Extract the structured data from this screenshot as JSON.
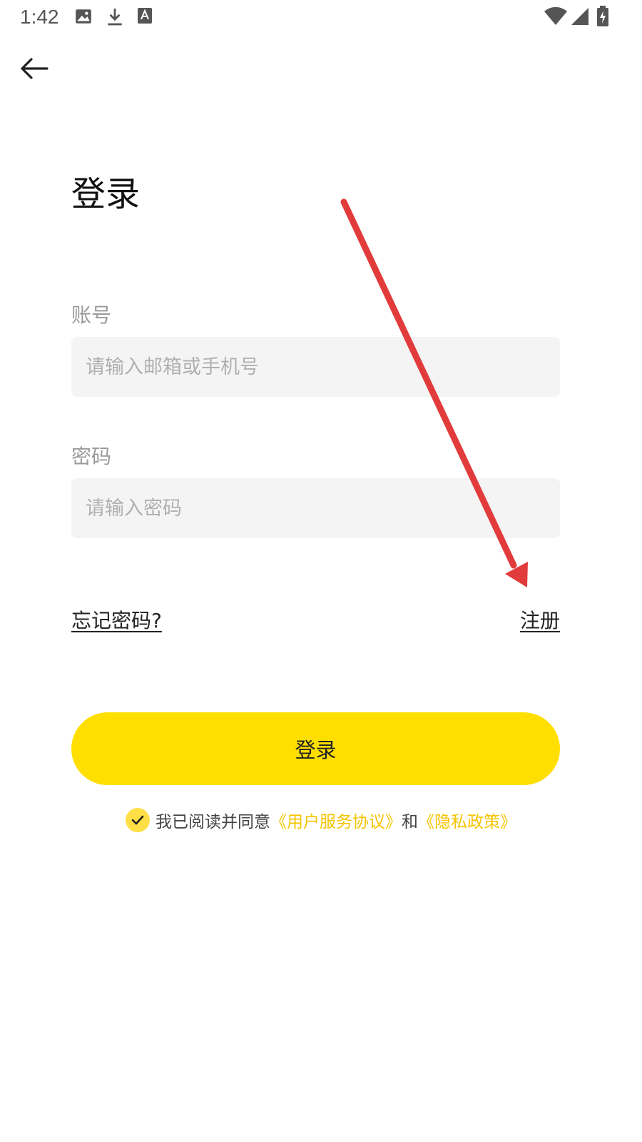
{
  "status_bar": {
    "time": "1:42",
    "icons": [
      "image-icon",
      "download-icon",
      "font-icon",
      "wifi-icon",
      "signal-icon",
      "battery-icon"
    ]
  },
  "header": {
    "back_icon": "arrow-left-icon"
  },
  "title": "登录",
  "form": {
    "account_label": "账号",
    "account_placeholder": "请输入邮箱或手机号",
    "account_value": "",
    "password_label": "密码",
    "password_placeholder": "请输入密码",
    "password_value": ""
  },
  "links": {
    "forgot_password": "忘记密码?",
    "register": "注册"
  },
  "login_button": "登录",
  "agreement": {
    "checked": true,
    "prefix": "我已阅读并同意",
    "user_agreement": "《用户服务协议》",
    "conjunction": "和",
    "privacy_policy": "《隐私政策》"
  },
  "colors": {
    "accent": "#ffdf00",
    "link_accent": "#f5c400",
    "input_bg": "#f4f4f4",
    "annotation": "#e23b3b"
  }
}
